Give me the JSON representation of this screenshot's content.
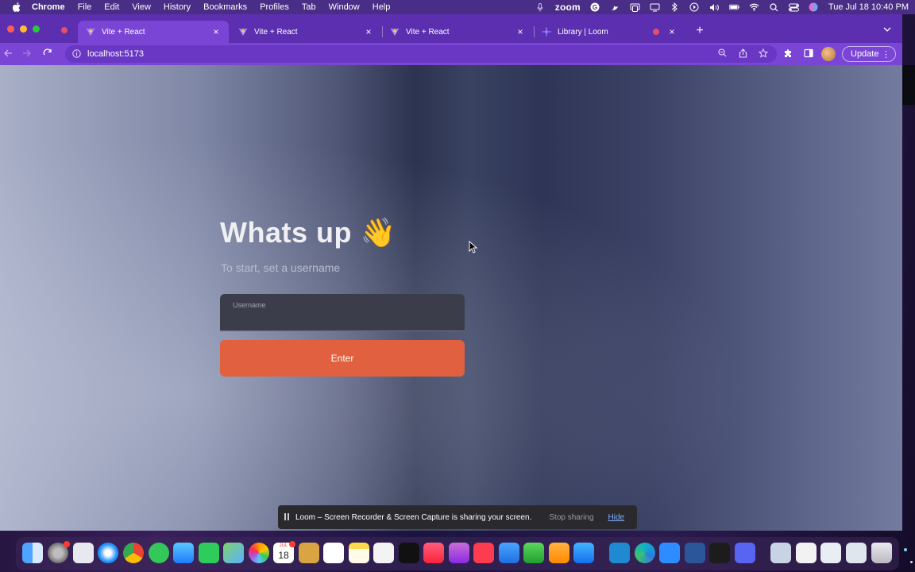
{
  "menubar": {
    "app_name": "Chrome",
    "menus": [
      "File",
      "Edit",
      "View",
      "History",
      "Bookmarks",
      "Profiles",
      "Tab",
      "Window",
      "Help"
    ],
    "zoom_label": "zoom",
    "clock": "Tue Jul 18  10:40 PM"
  },
  "browser": {
    "tabs": [
      {
        "title": "Vite + React",
        "active": true
      },
      {
        "title": "Vite + React",
        "active": false
      },
      {
        "title": "Vite + React",
        "active": false
      },
      {
        "title": "Library | Loom",
        "active": false
      }
    ],
    "url": "localhost:5173",
    "update_label": "Update"
  },
  "page": {
    "headline": "Whats up 👋",
    "subheadline": "To start, set a username",
    "username_label": "Username",
    "username_value": "",
    "enter_label": "Enter"
  },
  "loom": {
    "message": "Loom – Screen Recorder & Screen Capture is sharing your screen.",
    "stop_label": "Stop sharing",
    "hide_label": "Hide"
  },
  "dock": {
    "apps": [
      "finder",
      "system-settings",
      "launchpad",
      "safari",
      "chrome",
      "messages",
      "mail",
      "facetime",
      "maps",
      "photos",
      "calendar",
      "notes-app",
      "reminders",
      "notes",
      "freeform",
      "apple-tv",
      "music",
      "podcasts",
      "news",
      "keynote",
      "numbers",
      "pages",
      "app-store",
      "vscode",
      "edge",
      "zoom",
      "word",
      "terminal",
      "discord",
      "preview",
      "documents",
      "downloads",
      "trash"
    ],
    "calendar_month": "JUL",
    "calendar_day": "18",
    "badge_counts": {
      "system-settings": "1",
      "calendar": "3"
    }
  },
  "colors": {
    "accent_button": "#e0603f",
    "tab_active": "#7a45d4",
    "tab_strip": "#5b2fb0"
  }
}
